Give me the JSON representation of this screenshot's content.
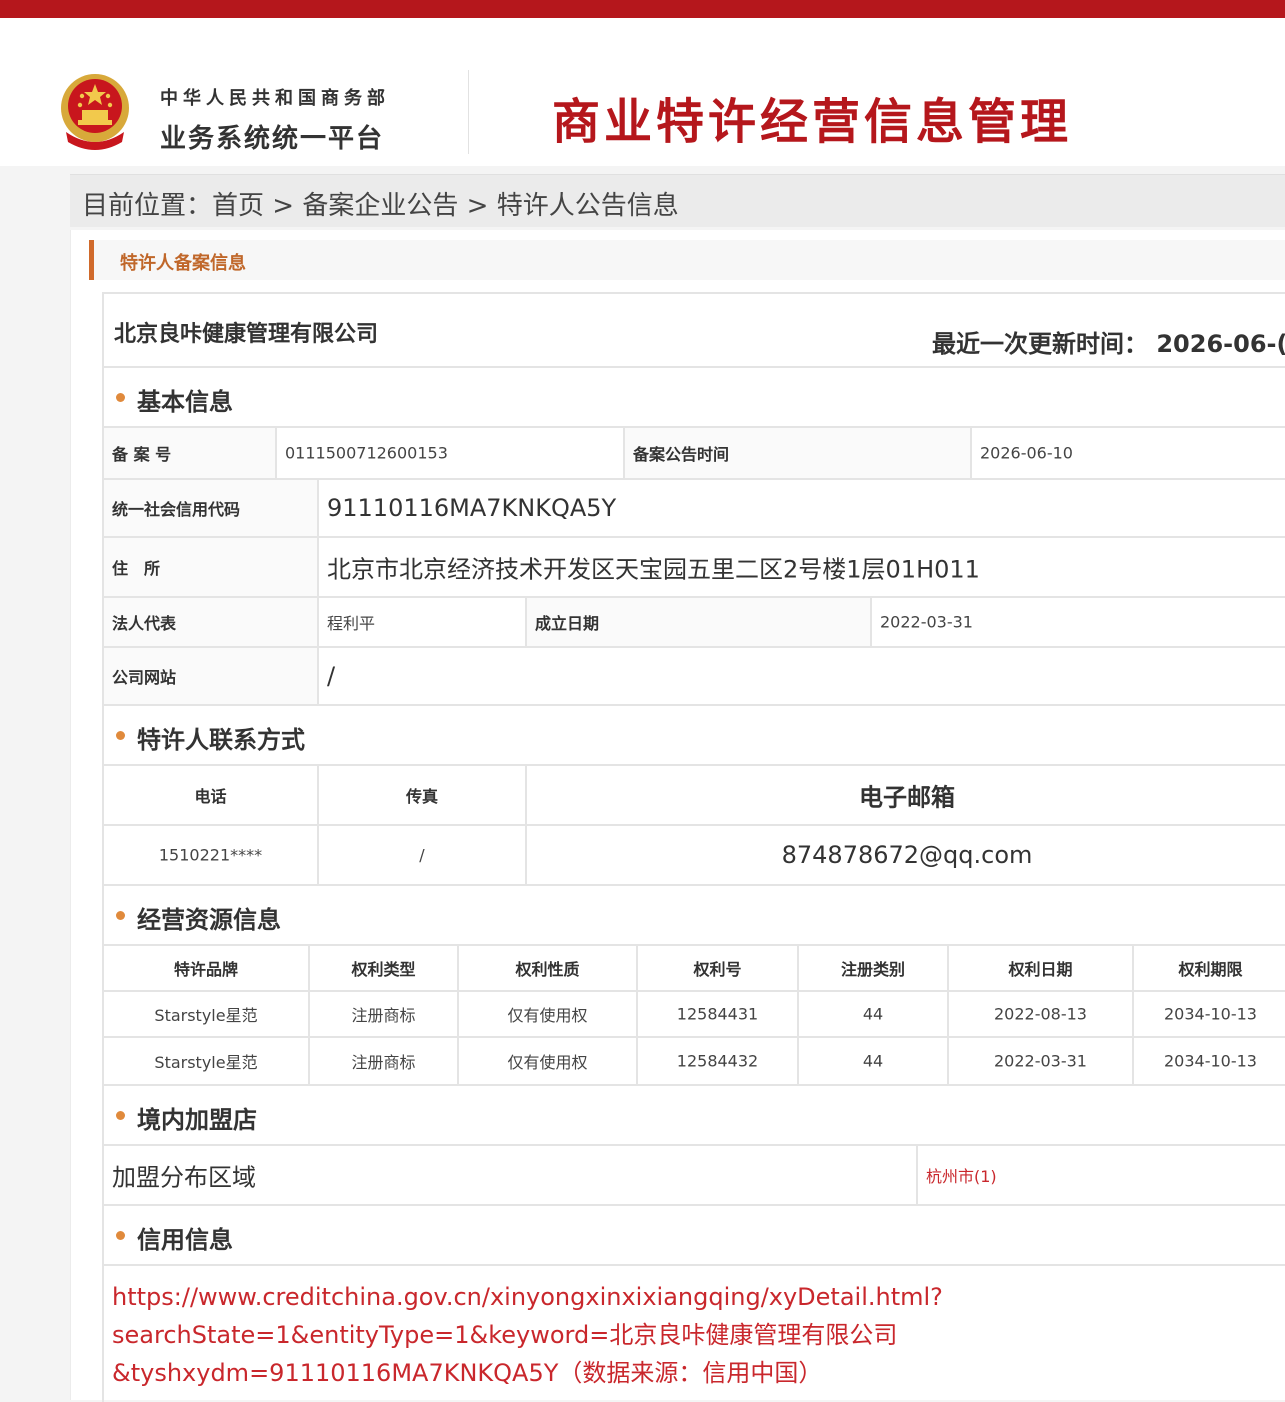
{
  "header": {
    "org_line1": "中华人民共和国商务部",
    "org_line2": "业务系统统一平台",
    "system_title": "商业特许经营信息管理"
  },
  "breadcrumb": {
    "prefix": "目前位置：",
    "items": [
      "首页",
      "备案企业公告",
      "特许人公告信息"
    ],
    "separator": ">"
  },
  "panel": {
    "title": "特许人备案信息"
  },
  "company": {
    "name": "北京良咔健康管理有限公司",
    "update_label": "最近一次更新时间：",
    "update_value": "2026-06-("
  },
  "basic": {
    "title": "基本信息",
    "record_no_label": "备 案 号",
    "record_no": "0111500712600153",
    "announce_time_label": "备案公告时间",
    "announce_time": "2026-06-10",
    "credit_code_label": "统一社会信用代码",
    "credit_code": "91110116MA7KNKQA5Y",
    "address_label": "住　所",
    "address": "北京市北京经济技术开发区天宝园五里二区2号楼1层01H011",
    "legal_rep_label": "法人代表",
    "legal_rep": "程利平",
    "found_date_label": "成立日期",
    "found_date": "2022-03-31",
    "website_label": "公司网站",
    "website": "/"
  },
  "contact": {
    "title": "特许人联系方式",
    "phone_label": "电话",
    "fax_label": "传真",
    "email_label": "电子邮箱",
    "phone": "1510221****",
    "fax": "/",
    "email": "874878672@qq.com"
  },
  "resources": {
    "title": "经营资源信息",
    "columns": [
      "特许品牌",
      "权利类型",
      "权利性质",
      "权利号",
      "注册类别",
      "权利日期",
      "权利期限"
    ],
    "rows": [
      [
        "Starstyle星范",
        "注册商标",
        "仅有使用权",
        "12584431",
        "44",
        "2022-08-13",
        "2034-10-13"
      ],
      [
        "Starstyle星范",
        "注册商标",
        "仅有使用权",
        "12584432",
        "44",
        "2022-03-31",
        "2034-10-13"
      ]
    ]
  },
  "stores": {
    "title": "境内加盟店",
    "area_label": "加盟分布区域",
    "area_value": "杭州市(1)"
  },
  "credit": {
    "title": "信用信息",
    "link_line1": "https://www.creditchina.gov.cn/xinyongxinxixiangqing/xyDetail.html?",
    "link_line2": "searchState=1&entityType=1&keyword=北京良咔健康管理有限公司",
    "link_line3": "&tyshxydm=91110116MA7KNKQA5Y",
    "source_note": "（数据来源：信用中国）"
  },
  "colors": {
    "brand_red": "#b5171c",
    "accent_orange": "#d06a2b",
    "link_red": "#c9272c"
  }
}
